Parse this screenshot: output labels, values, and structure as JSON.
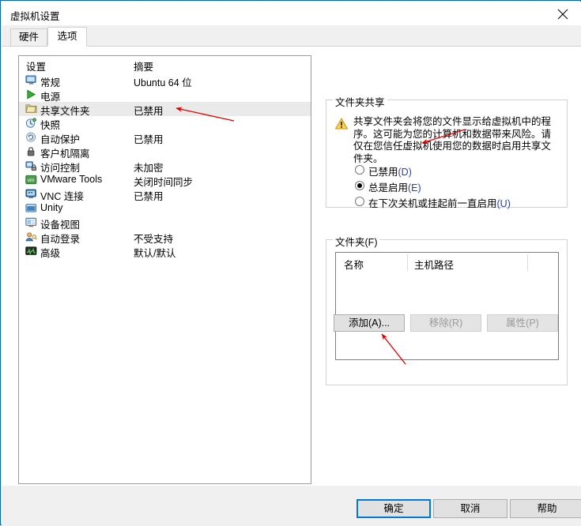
{
  "window": {
    "title": "虚拟机设置",
    "close_icon": "close-icon"
  },
  "tabs": [
    {
      "label": "硬件",
      "selected": false
    },
    {
      "label": "选项",
      "selected": true
    }
  ],
  "settings_list": {
    "columns": {
      "name": "设置",
      "summary": "摘要"
    },
    "rows": [
      {
        "icon": "monitor-icon",
        "label": "常规",
        "summary": "Ubuntu 64 位",
        "selected": false
      },
      {
        "icon": "play-icon",
        "label": "电源",
        "summary": "",
        "selected": false
      },
      {
        "icon": "folder-icon",
        "label": "共享文件夹",
        "summary": "已禁用",
        "selected": true
      },
      {
        "icon": "snapshot-icon",
        "label": "快照",
        "summary": "",
        "selected": false
      },
      {
        "icon": "autoprotect-icon",
        "label": "自动保护",
        "summary": "已禁用",
        "selected": false
      },
      {
        "icon": "lock-icon",
        "label": "客户机隔离",
        "summary": "",
        "selected": false
      },
      {
        "icon": "access-control-icon",
        "label": "访问控制",
        "summary": "未加密",
        "selected": false
      },
      {
        "icon": "vmware-tools-icon",
        "label": "VMware Tools",
        "summary": "关闭时间同步",
        "selected": false
      },
      {
        "icon": "vnc-icon",
        "label": "VNC 连接",
        "summary": "已禁用",
        "selected": false
      },
      {
        "icon": "unity-icon",
        "label": "Unity",
        "summary": "",
        "selected": false
      },
      {
        "icon": "device-view-icon",
        "label": "设备视图",
        "summary": "",
        "selected": false
      },
      {
        "icon": "auto-login-icon",
        "label": "自动登录",
        "summary": "不受支持",
        "selected": false
      },
      {
        "icon": "advanced-icon",
        "label": "高级",
        "summary": "默认/默认",
        "selected": false
      }
    ]
  },
  "folder_sharing": {
    "group_title": "文件夹共享",
    "warning_icon": "warning-icon",
    "warning_text": "共享文件夹会将您的文件显示给虚拟机中的程序。这可能为您的计算机和数据带来风险。请仅在您信任虚拟机使用您的数据时启用共享文件夹。",
    "options": [
      {
        "label": "已禁用",
        "mnemonic": "(D)",
        "checked": false
      },
      {
        "label": "总是启用",
        "mnemonic": "(E)",
        "checked": true
      },
      {
        "label": "在下次关机或挂起前一直启用",
        "mnemonic": "(U)",
        "checked": false
      }
    ]
  },
  "folders": {
    "group_title": "文件夹",
    "group_mnemonic": "(F)",
    "columns": [
      "名称",
      "主机路径"
    ],
    "rows": [],
    "buttons": [
      {
        "label": "添加(A)...",
        "enabled": true
      },
      {
        "label": "移除(R)",
        "enabled": false
      },
      {
        "label": "属性(P)",
        "enabled": false
      }
    ]
  },
  "dialog_buttons": [
    {
      "label": "确定",
      "default": true
    },
    {
      "label": "取消",
      "default": false
    },
    {
      "label": "帮助",
      "default": false
    }
  ],
  "colors": {
    "accent": "#0078d7",
    "mnemonic": "#2b3fb5",
    "selection": "#eaeaea",
    "annotation": "#e00000"
  }
}
